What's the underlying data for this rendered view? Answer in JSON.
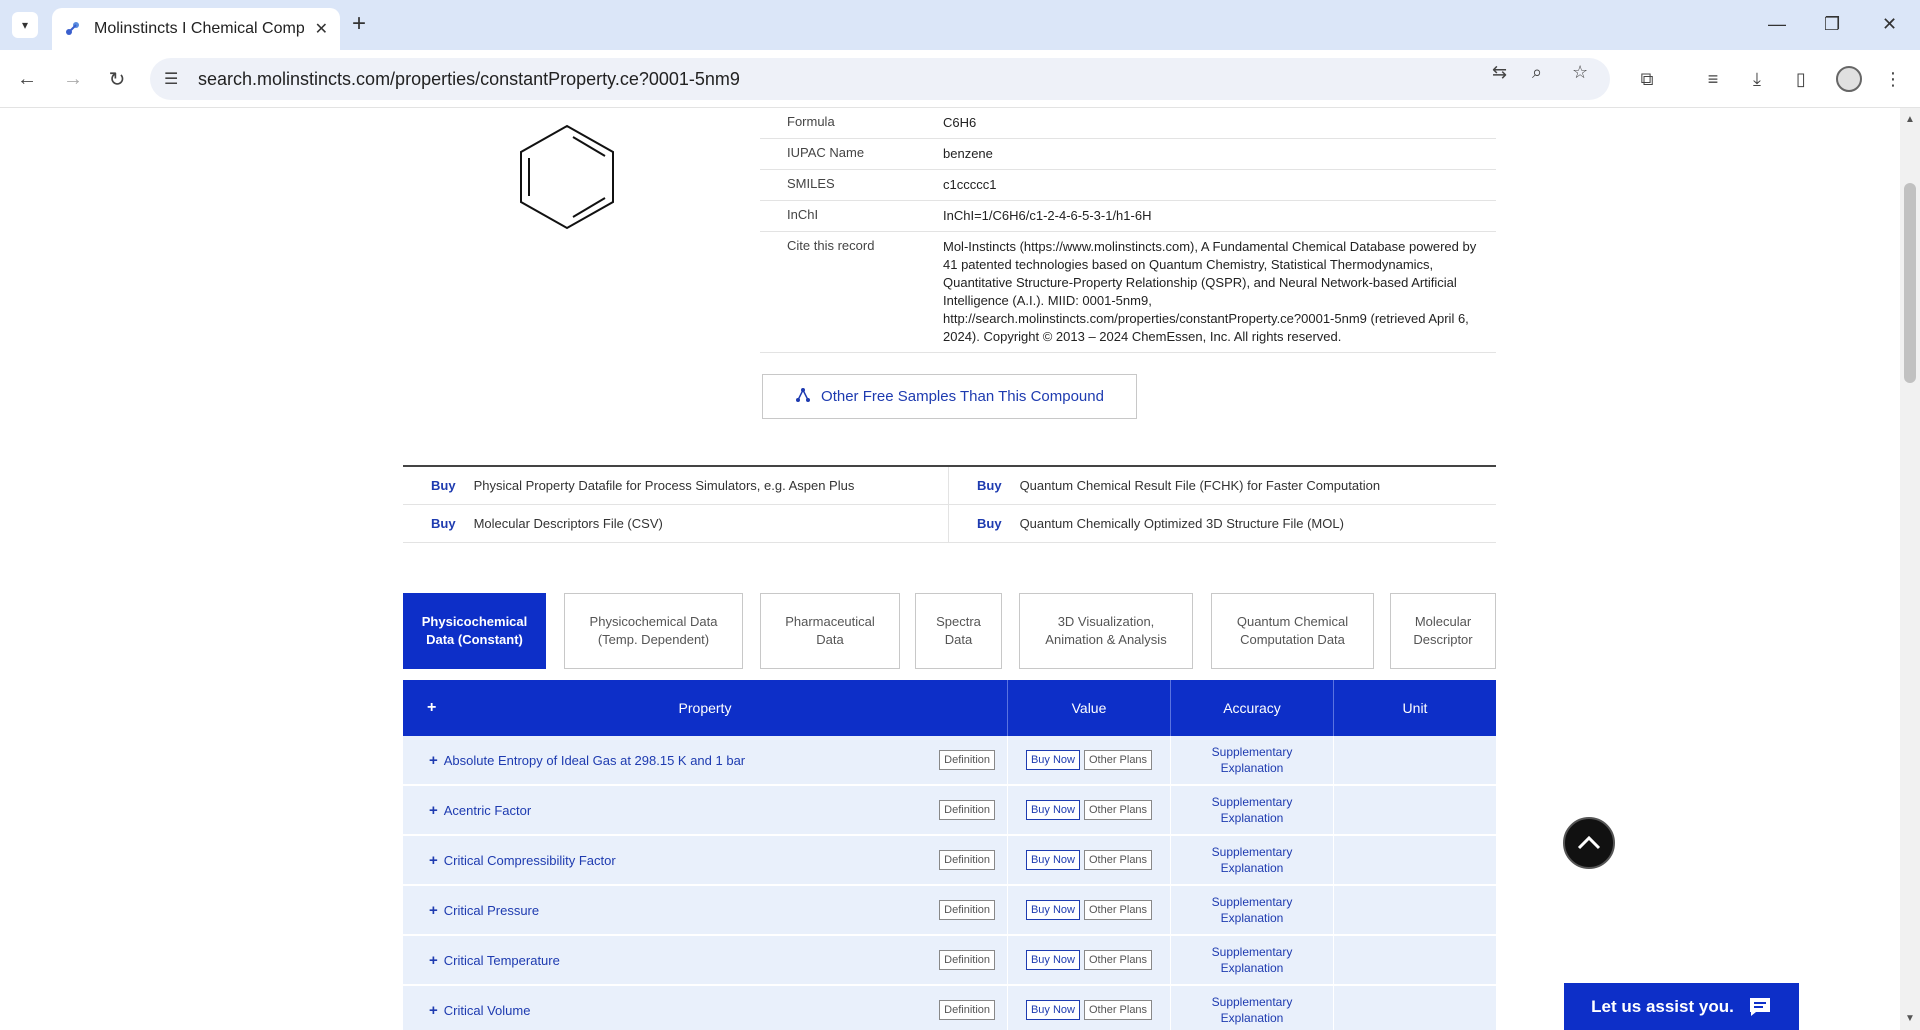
{
  "browser": {
    "tab_title": "Molinstincts I Chemical Compo",
    "url": "search.molinstincts.com/properties/constantProperty.ce?0001-5nm9"
  },
  "record": [
    {
      "label": "Formula",
      "value": "C6H6"
    },
    {
      "label": "IUPAC Name",
      "value": "benzene"
    },
    {
      "label": "SMILES",
      "value": "c1ccccc1"
    },
    {
      "label": "InChI",
      "value": "InChI=1/C6H6/c1-2-4-6-5-3-1/h1-6H"
    },
    {
      "label": "Cite this record",
      "value": "Mol-Instincts (https://www.molinstincts.com), A Fundamental Chemical Database powered by 41 patented technologies based on Quantum Chemistry, Statistical Thermodynamics, Quantitative Structure-Property Relationship (QSPR), and Neural Network-based Artificial Intelligence (A.I.). MIID: 0001-5nm9, http://search.molinstincts.com/properties/constantProperty.ce?0001-5nm9 (retrieved April 6, 2024). Copyright © 2013 – 2024 ChemEssen, Inc. All rights reserved."
    }
  ],
  "free_samples_label": "Other Free Samples Than This Compound",
  "buy_label": "Buy",
  "buy_items": [
    "Physical Property Datafile for Process Simulators, e.g. Aspen Plus",
    "Quantum Chemical Result File (FCHK) for Faster Computation",
    "Molecular Descriptors File (CSV)",
    "Quantum Chemically Optimized 3D Structure File (MOL)"
  ],
  "tabs": [
    {
      "line1": "Physicochemical",
      "line2": "Data (Constant)",
      "active": true
    },
    {
      "line1": "Physicochemical Data",
      "line2": "(Temp. Dependent)",
      "active": false
    },
    {
      "line1": "Pharmaceutical",
      "line2": "Data",
      "active": false
    },
    {
      "line1": "Spectra",
      "line2": "Data",
      "active": false
    },
    {
      "line1": "3D Visualization,",
      "line2": "Animation & Analysis",
      "active": false
    },
    {
      "line1": "Quantum Chemical",
      "line2": "Computation Data",
      "active": false
    },
    {
      "line1": "Molecular",
      "line2": "Descriptor",
      "active": false
    }
  ],
  "table": {
    "headers": {
      "plus": "+",
      "property": "Property",
      "value": "Value",
      "accuracy": "Accuracy",
      "unit": "Unit"
    },
    "definition_label": "Definition",
    "buy_now_label": "Buy Now",
    "other_plans_label": "Other Plans",
    "accuracy_line1": "Supplementary",
    "accuracy_line2": "Explanation",
    "rows": [
      "Absolute Entropy of Ideal Gas at 298.15 K and 1 bar",
      "Acentric Factor",
      "Critical Compressibility Factor",
      "Critical Pressure",
      "Critical Temperature",
      "Critical Volume"
    ]
  },
  "assist_label": "Let us assist you.",
  "colors": {
    "brand": "#0d2fc8",
    "link": "#1e3bb0"
  }
}
